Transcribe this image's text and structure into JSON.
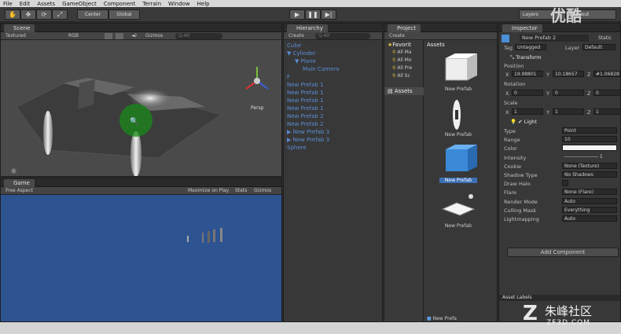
{
  "menu": [
    "File",
    "Edit",
    "Assets",
    "GameObject",
    "Component",
    "Terrain",
    "Window",
    "Help"
  ],
  "toolbar": {
    "center": "Center",
    "global": "Global",
    "layers": "Layers",
    "layout": "Layout"
  },
  "scene": {
    "tab": "Scene",
    "shading": "Textured",
    "render": "RGB",
    "gizmos": "Gizmos",
    "search": "Q-All",
    "persp": "Persp"
  },
  "game": {
    "tab": "Game",
    "aspect": "Free Aspect",
    "maximize": "Maximize on Play",
    "stats": "Stats",
    "gizmos": "Gizmos"
  },
  "hierarchy": {
    "tab": "Hierarchy",
    "create": "Create",
    "search": "Q-All",
    "items": [
      {
        "label": "Cube",
        "indent": 0,
        "arrow": ""
      },
      {
        "label": "Cylinder",
        "indent": 0,
        "arrow": "▼"
      },
      {
        "label": "Plane",
        "indent": 1,
        "arrow": "▼"
      },
      {
        "label": "Main Camera",
        "indent": 2,
        "arrow": ""
      },
      {
        "label": "F",
        "indent": 0,
        "arrow": ""
      },
      {
        "label": "New Prefab 1",
        "indent": 0,
        "arrow": ""
      },
      {
        "label": "New Prefab 1",
        "indent": 0,
        "arrow": ""
      },
      {
        "label": "New Prefab 1",
        "indent": 0,
        "arrow": ""
      },
      {
        "label": "New Prefab 1",
        "indent": 0,
        "arrow": ""
      },
      {
        "label": "New Prefab 2",
        "indent": 0,
        "arrow": ""
      },
      {
        "label": "New Prefab 2",
        "indent": 0,
        "arrow": ""
      },
      {
        "label": "New Prefab 3",
        "indent": 0,
        "arrow": "▶"
      },
      {
        "label": "New Prefab 3",
        "indent": 0,
        "arrow": "▶"
      },
      {
        "label": "Sphere",
        "indent": 0,
        "arrow": ""
      }
    ]
  },
  "project": {
    "tab": "Project",
    "create": "Create",
    "favorites": "Favorit",
    "fav_items": [
      "All Ma",
      "All Mo",
      "All Pre",
      "All Sc"
    ],
    "assets_header": "Assets",
    "assets_folder": "Assets",
    "asset_items": [
      "New Prefab",
      "New Prefab",
      "New Prefab",
      "New Prefab"
    ],
    "footer_item": "New Prefa"
  },
  "inspector": {
    "tab": "Inspector",
    "name": "New Prefab 2",
    "static": "Static",
    "tag_label": "Tag",
    "tag": "Untagged",
    "layer_label": "Layer",
    "layer": "Default",
    "transform": "Transform",
    "position": "Position",
    "pos": {
      "x": "19.98801",
      "y": "10.18657",
      "z": "#1.06828"
    },
    "rotation": "Rotation",
    "rot": {
      "x": "0",
      "y": "0",
      "z": "0"
    },
    "scale": "Scale",
    "scl": {
      "x": "1",
      "y": "1",
      "z": "1"
    },
    "light": "Light",
    "rows": [
      {
        "label": "Type",
        "value": "Point"
      },
      {
        "label": "Range",
        "value": "10"
      },
      {
        "label": "Color",
        "value": ""
      },
      {
        "label": "Intensity",
        "value": "1"
      },
      {
        "label": "Cookie",
        "value": "None (Texture)"
      },
      {
        "label": "Shadow Type",
        "value": "No Shadows"
      },
      {
        "label": "Draw Halo",
        "value": ""
      },
      {
        "label": "Flare",
        "value": "None (Flare)"
      },
      {
        "label": "Render Mode",
        "value": "Auto"
      },
      {
        "label": "Culling Mask",
        "value": "Everything"
      },
      {
        "label": "Lightmapping",
        "value": "Auto"
      }
    ],
    "add_component": "Add Component",
    "asset_labels": "Asset Labels"
  },
  "watermark": {
    "top": "优酷",
    "bottom": "朱峰社区",
    "url": "ZF3D.COM"
  },
  "colors": {
    "game_bg": "#2e5391",
    "selection_blue": "#3d6fb5",
    "hier_text": "#5b8dd6"
  }
}
